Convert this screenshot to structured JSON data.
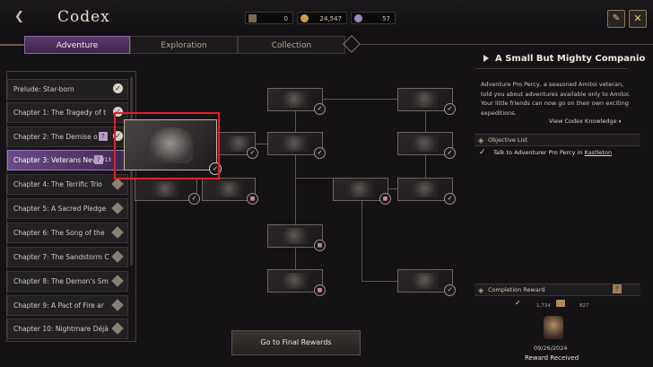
{
  "header": {
    "title": "Codex",
    "resources": [
      {
        "icon": "arrow-token-icon",
        "value": "0"
      },
      {
        "icon": "gold-coin-icon",
        "value": "24,547"
      },
      {
        "icon": "gem-icon",
        "value": "57"
      }
    ]
  },
  "tabs": [
    {
      "label": "Adventure",
      "active": true
    },
    {
      "label": "Exploration",
      "active": false
    },
    {
      "label": "Collection",
      "active": false
    }
  ],
  "chapters": [
    {
      "label": "Prelude: Star-born",
      "status": "complete"
    },
    {
      "label": "Chapter 1: The Tragedy of t",
      "status": "complete"
    },
    {
      "label": "Chapter 2: The Demise o",
      "status": "complete",
      "has_quest": true
    },
    {
      "label": "Chapter 3: Veterans Nev",
      "status": "active",
      "has_quest": true,
      "progress": "2/13"
    },
    {
      "label": "Chapter 4: The Terrific Trio",
      "status": "locked"
    },
    {
      "label": "Chapter 5: A Sacred Pledge",
      "status": "locked"
    },
    {
      "label": "Chapter 6: The Song of the",
      "status": "locked"
    },
    {
      "label": "Chapter 7: The Sandstorm C",
      "status": "locked"
    },
    {
      "label": "Chapter 8: The Demon's Sm",
      "status": "locked"
    },
    {
      "label": "Chapter 9: A Pact of Fire ar",
      "status": "locked"
    },
    {
      "label": "Chapter 10: Nightmare Déjà",
      "status": "locked"
    }
  ],
  "detail": {
    "title": "A Small But Mighty Companio",
    "description": "Adventure Pro Percy, a seasoned Amitoi veteran, told you about adventures available only to Amitoi. Your little friends can now go on their own exciting expeditions.",
    "view_link": "View Codex Knowledge",
    "objective_header": "Objective List",
    "objective_text": "Talk to Adventurer Pro Percy in ",
    "objective_location": "Kastleton",
    "completion_header": "Completion Reward",
    "reward_values": [
      "1,734",
      "827"
    ],
    "date": "09/26/2024",
    "reward_status": "Reward Received"
  },
  "final_button": "Go to Final Rewards",
  "colors": {
    "accent": "#6a4a88",
    "highlight": "#e0202a",
    "background": "#141214"
  }
}
